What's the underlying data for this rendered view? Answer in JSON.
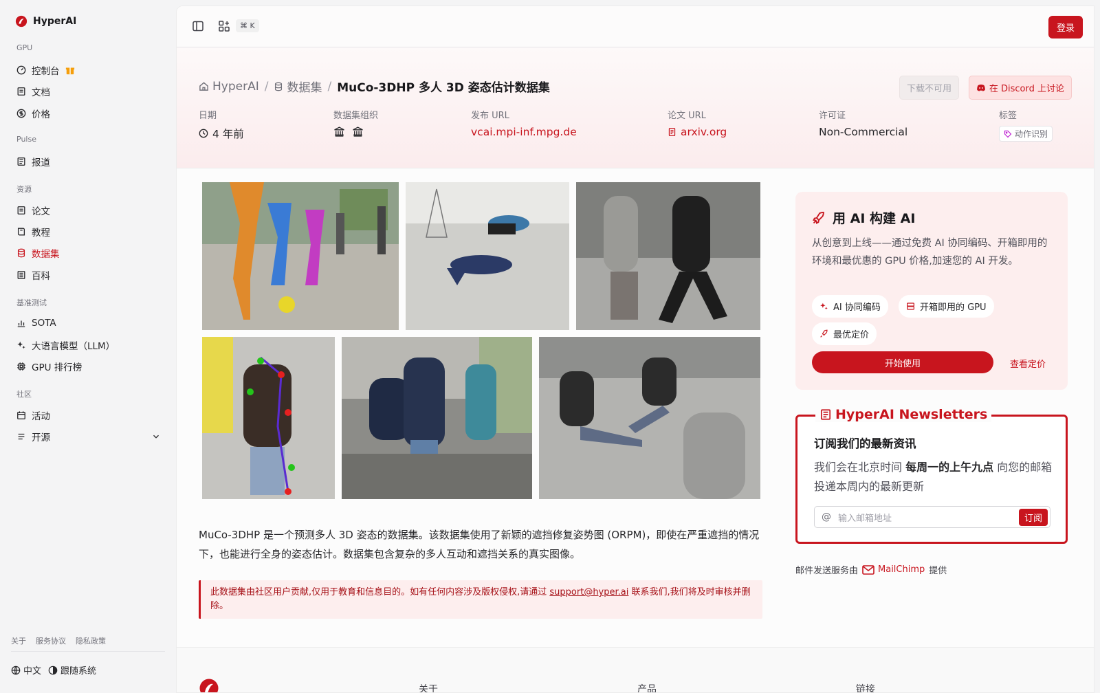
{
  "app": {
    "name": "HyperAI"
  },
  "sidebar": {
    "sections": [
      {
        "title": "GPU",
        "items": [
          {
            "label": "控制台",
            "icon": "gauge-icon"
          },
          {
            "label": "文档",
            "icon": "doc-icon"
          },
          {
            "label": "价格",
            "icon": "dollar-icon"
          }
        ]
      },
      {
        "title": "Pulse",
        "items": [
          {
            "label": "报道",
            "icon": "news-icon"
          }
        ]
      },
      {
        "title": "资源",
        "items": [
          {
            "label": "论文",
            "icon": "paper-icon"
          },
          {
            "label": "教程",
            "icon": "book-icon"
          },
          {
            "label": "数据集",
            "icon": "database-icon"
          },
          {
            "label": "百科",
            "icon": "wiki-icon"
          }
        ]
      },
      {
        "title": "基准测试",
        "items": [
          {
            "label": "SOTA",
            "icon": "chart-icon"
          },
          {
            "label": "大语言模型（LLM）",
            "icon": "sparkles-icon"
          },
          {
            "label": "GPU 排行榜",
            "icon": "cpu-icon"
          }
        ]
      },
      {
        "title": "社区",
        "items": [
          {
            "label": "活动",
            "icon": "calendar-icon"
          },
          {
            "label": "开源",
            "icon": "list-icon"
          }
        ]
      }
    ],
    "active": "数据集",
    "footer_links": [
      "关于",
      "服务协议",
      "隐私政策"
    ],
    "language": "中文",
    "theme": "跟随系统"
  },
  "topbar": {
    "shortcut": "⌘ K",
    "login": "登录"
  },
  "breadcrumb": {
    "home": "HyperAI",
    "section": "数据集",
    "current": "MuCo-3DHP 多人 3D 姿态估计数据集"
  },
  "actions": {
    "download": "下载不可用",
    "discord": "在 Discord 上讨论"
  },
  "meta": {
    "date_label": "日期",
    "date_value": "4 年前",
    "org_label": "数据集组织",
    "url_label": "发布 URL",
    "url_value": "vcai.mpi-inf.mpg.de",
    "paper_label": "论文 URL",
    "paper_value": "arxiv.org",
    "license_label": "许可证",
    "license_value": "Non-Commercial",
    "tags_label": "标签",
    "tag": "动作识别"
  },
  "description": "MuCo-3DHP 是一个预测多人 3D 姿态的数据集。该数据集使用了新颖的遮挡修复姿势图 (ORPM)，即使在严重遮挡的情况下，也能进行全身的姿态估计。数据集包含复杂的多人互动和遮挡关系的真实图像。",
  "notice": {
    "pre": "此数据集由社区用户贡献,仅用于教育和信息目的。如有任何内容涉及版权侵权,请通过 ",
    "email": "support@hyper.ai",
    "post": " 联系我们,我们将及时审核并删除。"
  },
  "promo": {
    "title": "用 AI 构建 AI",
    "text": "从创意到上线——通过免费 AI 协同编码、开箱即用的环境和最优惠的 GPU 价格,加速您的 AI 开发。",
    "chips": [
      "AI 协同编码",
      "开箱即用的 GPU",
      "最优定价"
    ],
    "start": "开始使用",
    "pricing": "查看定价"
  },
  "newsletter": {
    "title": "HyperAI Newsletters",
    "heading": "订阅我们的最新资讯",
    "text_pre": "我们会在北京时间 ",
    "text_bold": "每周一的上午九点",
    "text_post": " 向您的邮箱投递本周内的最新更新",
    "placeholder": "输入邮箱地址",
    "subscribe": "订阅",
    "provider_pre": "邮件发送服务由",
    "provider": "MailChimp",
    "provider_post": "提供"
  },
  "footer": {
    "cols": [
      "关于",
      "产品",
      "链接"
    ]
  },
  "colors": {
    "accent": "#c8151e",
    "background": "#f4f4f5"
  }
}
